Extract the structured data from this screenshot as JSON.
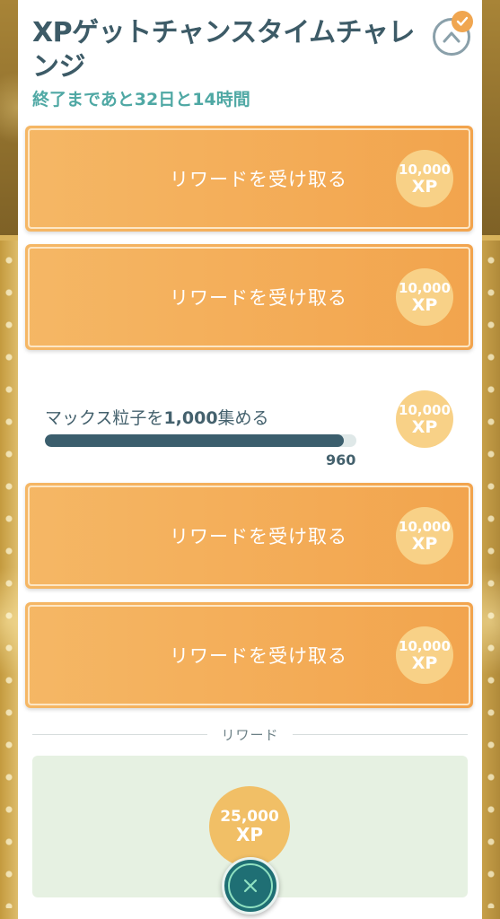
{
  "header": {
    "title": "XPゲットチャンスタイムチャレンジ",
    "subtitle": "終了まであと32日と14時間"
  },
  "tasks": [
    {
      "label": "リワードを受け取る",
      "xp_amount": "10,000",
      "xp_unit": "XP"
    },
    {
      "label": "リワードを受け取る",
      "xp_amount": "10,000",
      "xp_unit": "XP"
    },
    {
      "label": "リワードを受け取る",
      "xp_amount": "10,000",
      "xp_unit": "XP"
    },
    {
      "label": "リワードを受け取る",
      "xp_amount": "10,000",
      "xp_unit": "XP"
    }
  ],
  "progress_task": {
    "text_before": "マックス粒子を",
    "text_bold": "1,000",
    "text_after": "集める",
    "current_value": "960",
    "target_value": 1000,
    "progress_fraction": 0.96,
    "xp_amount": "10,000",
    "xp_unit": "XP"
  },
  "reward_section": {
    "label": "リワード",
    "xp_amount": "25,000",
    "xp_unit": "XP"
  },
  "icons": {
    "collapse": "chevron-up-icon",
    "completed": "check-icon",
    "close": "close-icon"
  },
  "colors": {
    "title": "#3d5b67",
    "subtitle": "#4fa8a4",
    "task_orange": "#f2a44d",
    "xp_badge": "#f8d187",
    "progress_fill": "#3b5e6d",
    "reward_bg": "#e6f1e2",
    "close_button": "#1f6f74"
  }
}
